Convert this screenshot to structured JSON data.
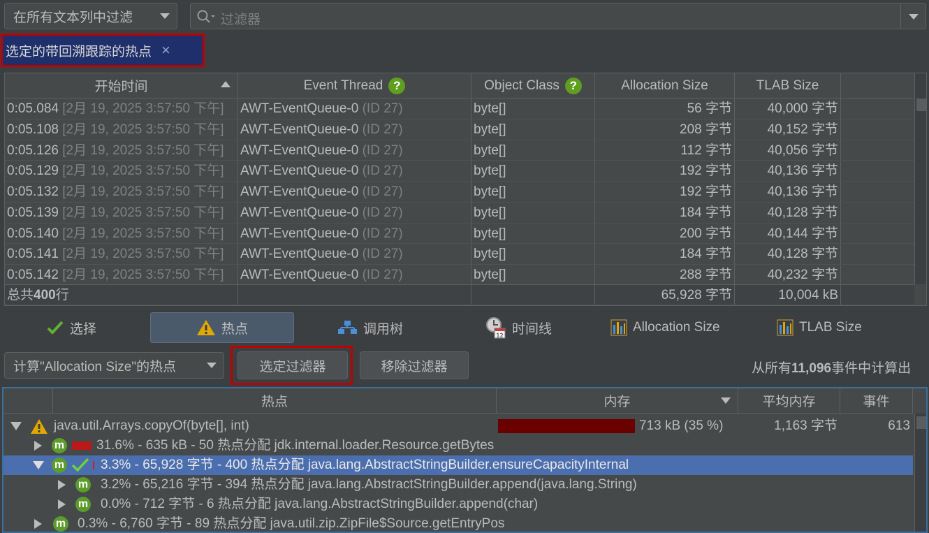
{
  "filter_bar": {
    "scope_label": "在所有文本列中过滤",
    "search_placeholder": "过滤器"
  },
  "active_filter": {
    "label": "选定的带回溯跟踪的热点",
    "close": "×"
  },
  "event_table": {
    "headers": {
      "start_time": "开始时间",
      "event_thread": "Event Thread",
      "object_class": "Object Class",
      "allocation_size": "Allocation Size",
      "tlab_size": "TLAB Size",
      "help": "?"
    },
    "rows": [
      {
        "time": "0:05.084",
        "date": "[2月 19, 2025 3:57:50 下午]",
        "thread": "AWT-EventQueue-0",
        "thread_id": "(ID 27)",
        "class": "byte[]",
        "alloc": "56 字节",
        "tlab": "40,000 字节"
      },
      {
        "time": "0:05.108",
        "date": "[2月 19, 2025 3:57:50 下午]",
        "thread": "AWT-EventQueue-0",
        "thread_id": "(ID 27)",
        "class": "byte[]",
        "alloc": "208 字节",
        "tlab": "40,152 字节"
      },
      {
        "time": "0:05.126",
        "date": "[2月 19, 2025 3:57:50 下午]",
        "thread": "AWT-EventQueue-0",
        "thread_id": "(ID 27)",
        "class": "byte[]",
        "alloc": "112 字节",
        "tlab": "40,056 字节"
      },
      {
        "time": "0:05.129",
        "date": "[2月 19, 2025 3:57:50 下午]",
        "thread": "AWT-EventQueue-0",
        "thread_id": "(ID 27)",
        "class": "byte[]",
        "alloc": "192 字节",
        "tlab": "40,136 字节"
      },
      {
        "time": "0:05.132",
        "date": "[2月 19, 2025 3:57:50 下午]",
        "thread": "AWT-EventQueue-0",
        "thread_id": "(ID 27)",
        "class": "byte[]",
        "alloc": "192 字节",
        "tlab": "40,136 字节"
      },
      {
        "time": "0:05.139",
        "date": "[2月 19, 2025 3:57:50 下午]",
        "thread": "AWT-EventQueue-0",
        "thread_id": "(ID 27)",
        "class": "byte[]",
        "alloc": "184 字节",
        "tlab": "40,128 字节"
      },
      {
        "time": "0:05.140",
        "date": "[2月 19, 2025 3:57:50 下午]",
        "thread": "AWT-EventQueue-0",
        "thread_id": "(ID 27)",
        "class": "byte[]",
        "alloc": "200 字节",
        "tlab": "40,144 字节"
      },
      {
        "time": "0:05.141",
        "date": "[2月 19, 2025 3:57:50 下午]",
        "thread": "AWT-EventQueue-0",
        "thread_id": "(ID 27)",
        "class": "byte[]",
        "alloc": "184 字节",
        "tlab": "40,128 字节"
      },
      {
        "time": "0:05.142",
        "date": "[2月 19, 2025 3:57:50 下午]",
        "thread": "AWT-EventQueue-0",
        "thread_id": "(ID 27)",
        "class": "byte[]",
        "alloc": "288 字节",
        "tlab": "40,232 字节"
      }
    ],
    "totals": {
      "label_prefix": "总共",
      "count": "400",
      "label_suffix": "行",
      "alloc": "65,928 字节",
      "tlab": "10,004 kB"
    }
  },
  "view_tabs": [
    {
      "label": "选择",
      "icon": "checkmark-icon"
    },
    {
      "label": "热点",
      "icon": "warning-icon"
    },
    {
      "label": "调用树",
      "icon": "call-tree-icon"
    },
    {
      "label": "时间线",
      "icon": "timeline-icon"
    },
    {
      "label": "Allocation Size",
      "icon": "bar-chart-icon"
    },
    {
      "label": "TLAB Size",
      "icon": "bar-chart-icon"
    }
  ],
  "hotspot_controls": {
    "calc_select": "计算\"Allocation Size\"的热点",
    "select_filter_button": "选定过滤器",
    "remove_filter_button": "移除过滤器",
    "summary_prefix": "从所有",
    "summary_count": "11,096",
    "summary_suffix": "事件中计算出"
  },
  "hotspot_tree": {
    "headers": {
      "hotspot": "热点",
      "memory": "内存",
      "avg_memory": "平均内存",
      "events": "事件"
    },
    "root": {
      "name": "java.util.Arrays.copyOf(byte[], int)",
      "memory": "713 kB (35 %)",
      "memory_fraction": 0.35,
      "avg": "1,163 字节",
      "events": "613"
    },
    "children": [
      {
        "text": "31.6% - 635 kB - 50 热点分配 jdk.internal.loader.Resource.getBytes",
        "fraction": 0.316
      },
      {
        "text": "3.3% - 65,928 字节 - 400 热点分配 java.lang.AbstractStringBuilder.ensureCapacityInternal",
        "fraction": 0.033
      },
      {
        "text": "3.2% - 65,216 字节 - 394 热点分配 java.lang.AbstractStringBuilder.append(java.lang.String)",
        "fraction": 0.032
      },
      {
        "text": "0.0% - 712 字节 - 6 热点分配 java.lang.AbstractStringBuilder.append(char)",
        "fraction": 0.0
      },
      {
        "text": "0.3% - 6,760 字节 - 89 热点分配 java.util.zip.ZipFile$Source.getEntryPos",
        "fraction": 0.003
      }
    ]
  },
  "colors": {
    "background": "#3c3f41",
    "selection": "#4b6eaf",
    "highlight_red": "#c00000",
    "memory_bar": "#6b0000",
    "method_icon": "#5c9c2a"
  }
}
